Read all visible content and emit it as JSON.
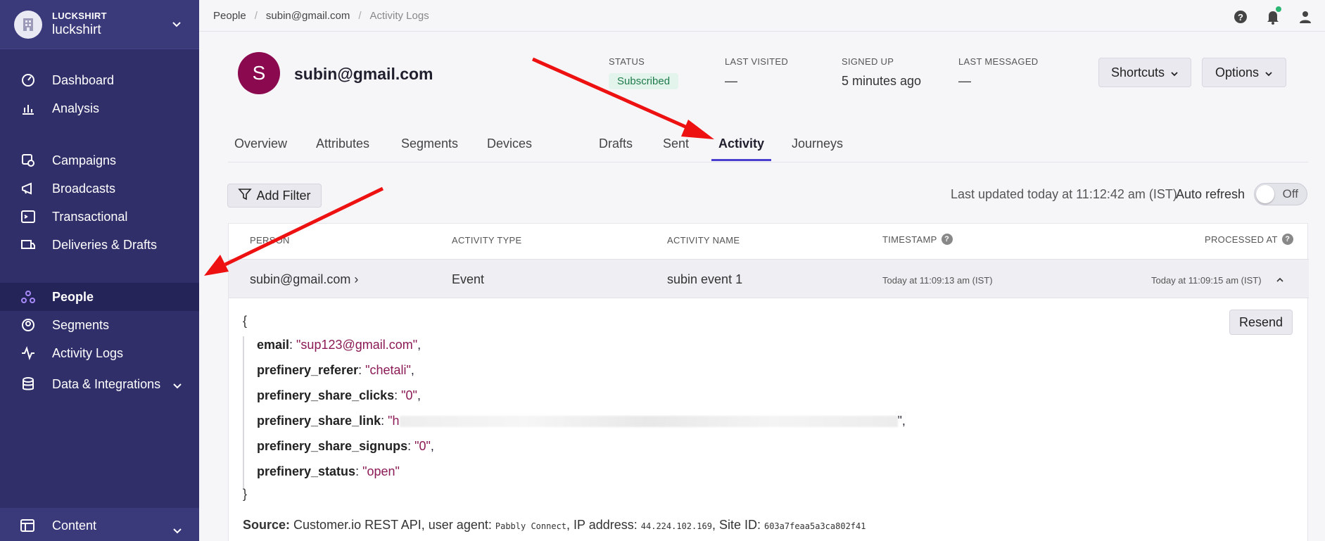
{
  "workspace": {
    "org": "LUCKSHIRT",
    "name": "luckshirt"
  },
  "sidebar": {
    "items": [
      {
        "label": "Dashboard",
        "icon": "dashboard-icon"
      },
      {
        "label": "Analysis",
        "icon": "bar-chart-icon"
      },
      {
        "label": "Campaigns",
        "icon": "campaigns-icon"
      },
      {
        "label": "Broadcasts",
        "icon": "megaphone-icon"
      },
      {
        "label": "Transactional",
        "icon": "terminal-icon"
      },
      {
        "label": "Deliveries & Drafts",
        "icon": "deliveries-icon"
      },
      {
        "label": "People",
        "icon": "people-icon"
      },
      {
        "label": "Segments",
        "icon": "segments-icon"
      },
      {
        "label": "Activity Logs",
        "icon": "pulse-icon"
      },
      {
        "label": "Data & Integrations",
        "icon": "database-icon"
      }
    ],
    "active": "People",
    "content": "Content"
  },
  "breadcrumb": [
    "People",
    "subin@gmail.com",
    "Activity Logs"
  ],
  "profile": {
    "initial": "S",
    "email": "subin@gmail.com",
    "stats": [
      {
        "label": "STATUS",
        "value": "Subscribed"
      },
      {
        "label": "LAST VISITED",
        "value": "—"
      },
      {
        "label": "SIGNED UP",
        "value": "5 minutes ago"
      },
      {
        "label": "LAST MESSAGED",
        "value": "—"
      }
    ],
    "shortcuts": "Shortcuts",
    "options": "Options"
  },
  "tabs": [
    "Overview",
    "Attributes",
    "Segments",
    "Devices",
    "Drafts",
    "Sent",
    "Activity",
    "Journeys"
  ],
  "active_tab": "Activity",
  "filter": {
    "add_filter": "Add Filter",
    "last_updated": "Last updated today at 11:12:42 am (IST)",
    "auto_refresh": "Auto refresh",
    "toggle": "Off"
  },
  "table": {
    "headers": [
      "PERSON",
      "ACTIVITY TYPE",
      "ACTIVITY NAME",
      "TIMESTAMP",
      "PROCESSED AT"
    ],
    "row": {
      "person": "subin@gmail.com ›",
      "type": "Event",
      "name": "subin event 1",
      "timestamp": "Today at 11:09:13 am (IST)",
      "processed": "Today at 11:09:15 am (IST)"
    },
    "json": {
      "open": "{",
      "close": "}",
      "lines": [
        {
          "key": "email",
          "value": "\"sup123@gmail.com\""
        },
        {
          "key": "prefinery_referer",
          "value": "\"chetali\""
        },
        {
          "key": "prefinery_share_clicks",
          "value": "\"0\""
        },
        {
          "key": "prefinery_share_link",
          "value": "\"h"
        },
        {
          "key": "prefinery_share_signups",
          "value": "\"0\""
        },
        {
          "key": "prefinery_status",
          "value": "\"open\""
        }
      ]
    },
    "resend": "Resend",
    "source": {
      "label": "Source:",
      "text1": "Customer.io REST API, user agent:",
      "agent": "Pabbly Connect",
      "text2": ", IP address:",
      "ip": "44.224.102.169",
      "text3": ", Site ID:",
      "site": "603a7feaa5a3ca802f41"
    }
  }
}
